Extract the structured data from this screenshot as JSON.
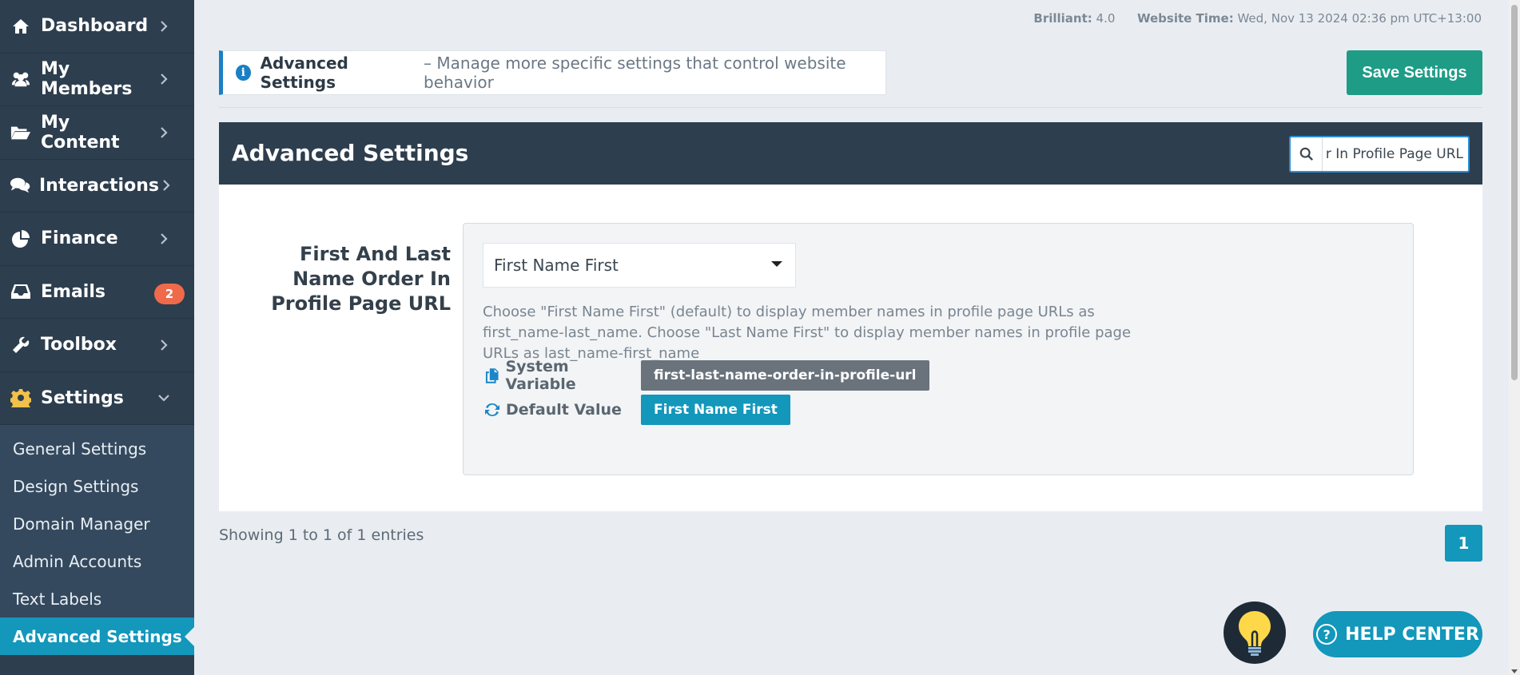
{
  "sidebar": {
    "items": [
      {
        "label": "Dashboard",
        "icon": "home-icon"
      },
      {
        "label": "My Members",
        "icon": "users-icon"
      },
      {
        "label": "My Content",
        "icon": "folder-open-icon"
      },
      {
        "label": "Interactions",
        "icon": "comments-icon"
      },
      {
        "label": "Finance",
        "icon": "pie-chart-icon"
      },
      {
        "label": "Emails",
        "icon": "inbox-icon",
        "badge": "2"
      },
      {
        "label": "Toolbox",
        "icon": "wrench-icon"
      },
      {
        "label": "Settings",
        "icon": "gear-icon"
      }
    ],
    "sub_items": [
      {
        "label": "General Settings"
      },
      {
        "label": "Design Settings"
      },
      {
        "label": "Domain Manager"
      },
      {
        "label": "Admin Accounts"
      },
      {
        "label": "Text Labels"
      },
      {
        "label": "Advanced Settings",
        "active": true
      }
    ]
  },
  "top_info": {
    "version_label": "Brilliant:",
    "version_value": "4.0",
    "time_label": "Website Time:",
    "time_value": "Wed, Nov 13 2024 02:36 pm UTC+13:00"
  },
  "banner": {
    "title": "Advanced Settings",
    "text": "– Manage more specific settings that control website behavior"
  },
  "save_button": "Save Settings",
  "panel": {
    "title": "Advanced Settings",
    "search_value": "r In Profile Page URL"
  },
  "setting": {
    "label": "First And Last Name Order In Profile Page URL",
    "selected": "First Name First",
    "description": "Choose \"First Name First\" (default) to display member names in profile page URLs as first_name-last_name. Choose \"Last Name First\" to display member names in profile page URLs as last_name-first_name",
    "system_variable_label": "System Variable",
    "system_variable_value": "first-last-name-order-in-profile-url",
    "default_value_label": "Default Value",
    "default_value_value": "First Name First"
  },
  "pagination": {
    "entries_text": "Showing 1 to 1 of 1 entries",
    "current_page": "1"
  },
  "help_center": "HELP CENTER",
  "colors": {
    "sidebar_bg": "#2d3e4e",
    "accent_teal": "#1397bb",
    "save_green": "#1f9c86",
    "badge_orange": "#ef6a4a"
  }
}
